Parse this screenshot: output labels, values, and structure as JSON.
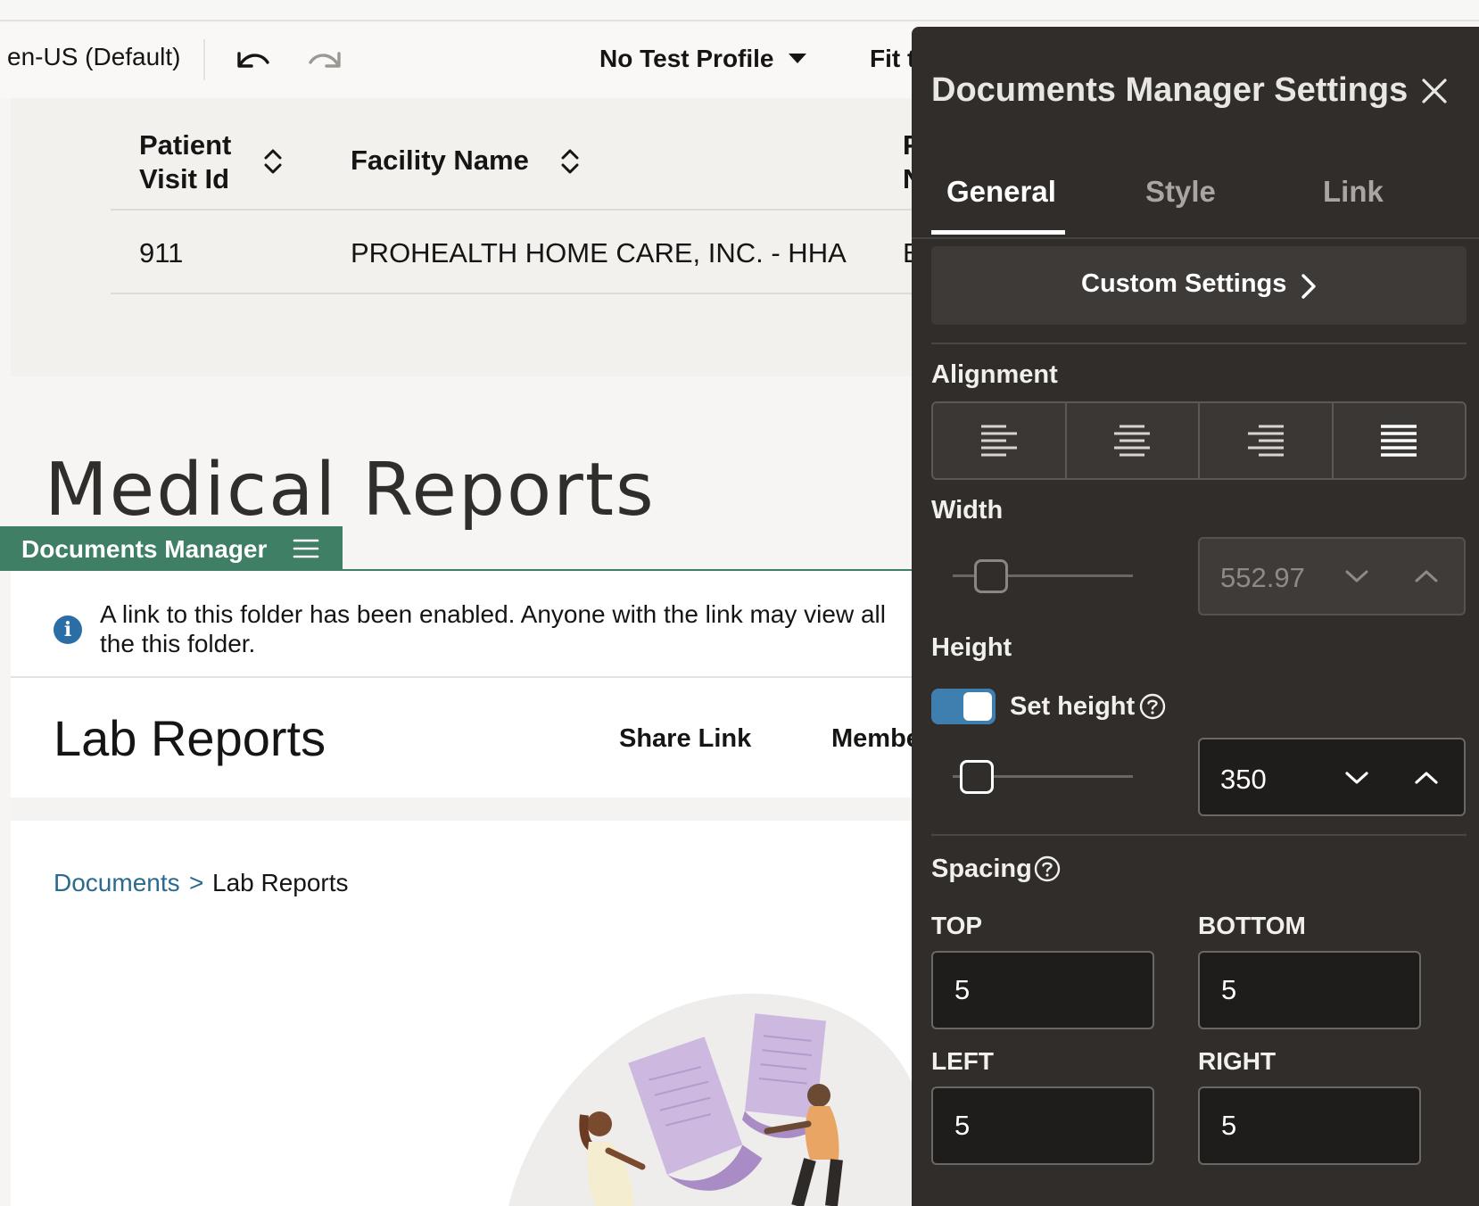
{
  "toolbar": {
    "locale": "en-US (Default)",
    "test_profile": "No Test Profile",
    "fit_label": "Fit t"
  },
  "table": {
    "headers": [
      "Patient Visit Id",
      "Facility Name",
      "P N"
    ],
    "rows": [
      [
        "911",
        "PROHEALTH HOME CARE, INC. - HHA",
        "E"
      ]
    ]
  },
  "page": {
    "heading": "Medical Reports"
  },
  "documents_manager": {
    "tab_label": "Documents Manager",
    "notice": "A link to this folder has been enabled. Anyone with the link may view all the this folder.",
    "folder_title": "Lab Reports",
    "share_link_label": "Share Link",
    "members_label": "Membe",
    "breadcrumb": {
      "root": "Documents",
      "separator": ">",
      "current": "Lab Reports"
    }
  },
  "settings": {
    "title": "Documents Manager Settings",
    "tabs": [
      "General",
      "Style",
      "Link"
    ],
    "active_tab": "General",
    "custom_settings_label": "Custom Settings",
    "alignment_label": "Alignment",
    "alignment_options": [
      "left",
      "center",
      "right",
      "justify"
    ],
    "alignment_selected": "justify",
    "width_label": "Width",
    "width_value": "552.97",
    "height_label": "Height",
    "set_height_label": "Set height",
    "set_height_enabled": true,
    "height_value": "350",
    "spacing_label": "Spacing",
    "spacing": {
      "top_label": "TOP",
      "top": "5",
      "bottom_label": "BOTTOM",
      "bottom": "5",
      "left_label": "LEFT",
      "left": "5",
      "right_label": "RIGHT",
      "right": "5"
    }
  },
  "colors": {
    "panel_bg": "#302d2a",
    "dm_green": "#3f7f66",
    "link_blue": "#2a6a8d",
    "toggle_blue": "#3e7fb0"
  }
}
